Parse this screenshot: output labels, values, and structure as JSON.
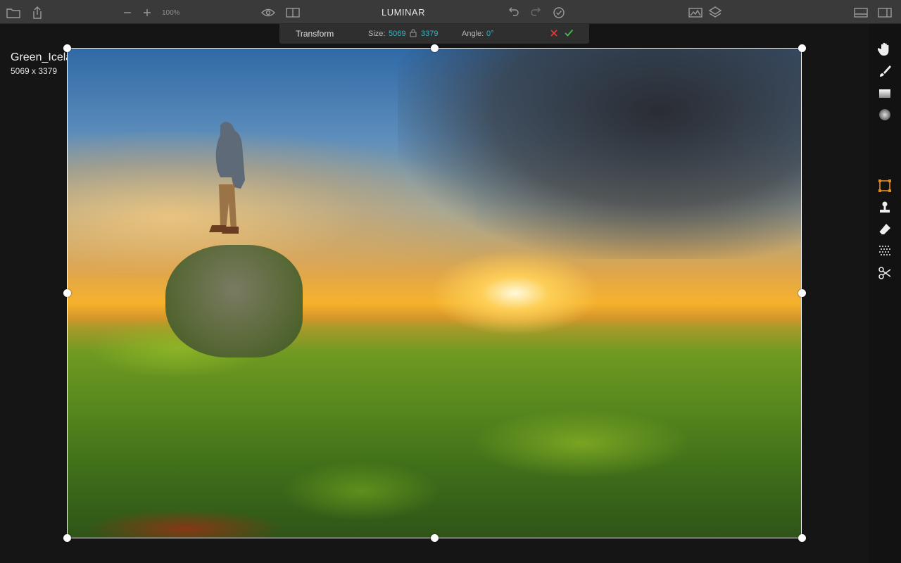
{
  "app": {
    "title": "LUMINAR"
  },
  "toolbar": {
    "zoom_level": "100%",
    "icons": [
      "folder-icon",
      "share-icon",
      "zoom-out-icon",
      "zoom-in-icon",
      "eye-icon",
      "compare-icon",
      "undo-icon",
      "redo-icon",
      "history-icon",
      "histogram-icon",
      "layers-icon",
      "filmstrip-icon",
      "panel-icon"
    ]
  },
  "transform": {
    "title": "Transform",
    "size_label": "Size:",
    "width": "5069",
    "height": "3379",
    "angle_label": "Angle:",
    "angle_value": "0°"
  },
  "file": {
    "name": "Green_Iceland.jpg",
    "dimensions": "5069 x 3379"
  },
  "sidebar": {
    "tools": [
      "hand-tool-icon",
      "brush-tool-icon",
      "gradient-tool-icon",
      "radial-tool-icon",
      "transform-tool-icon",
      "clone-stamp-icon",
      "erase-icon",
      "noise-icon",
      "crop-scissors-icon"
    ],
    "active_tool": "transform-tool-icon"
  },
  "colors": {
    "accent": "#2fb5c7",
    "active_tool": "#e38a1e",
    "cancel": "#e23a3a",
    "confirm": "#3cc24a"
  }
}
